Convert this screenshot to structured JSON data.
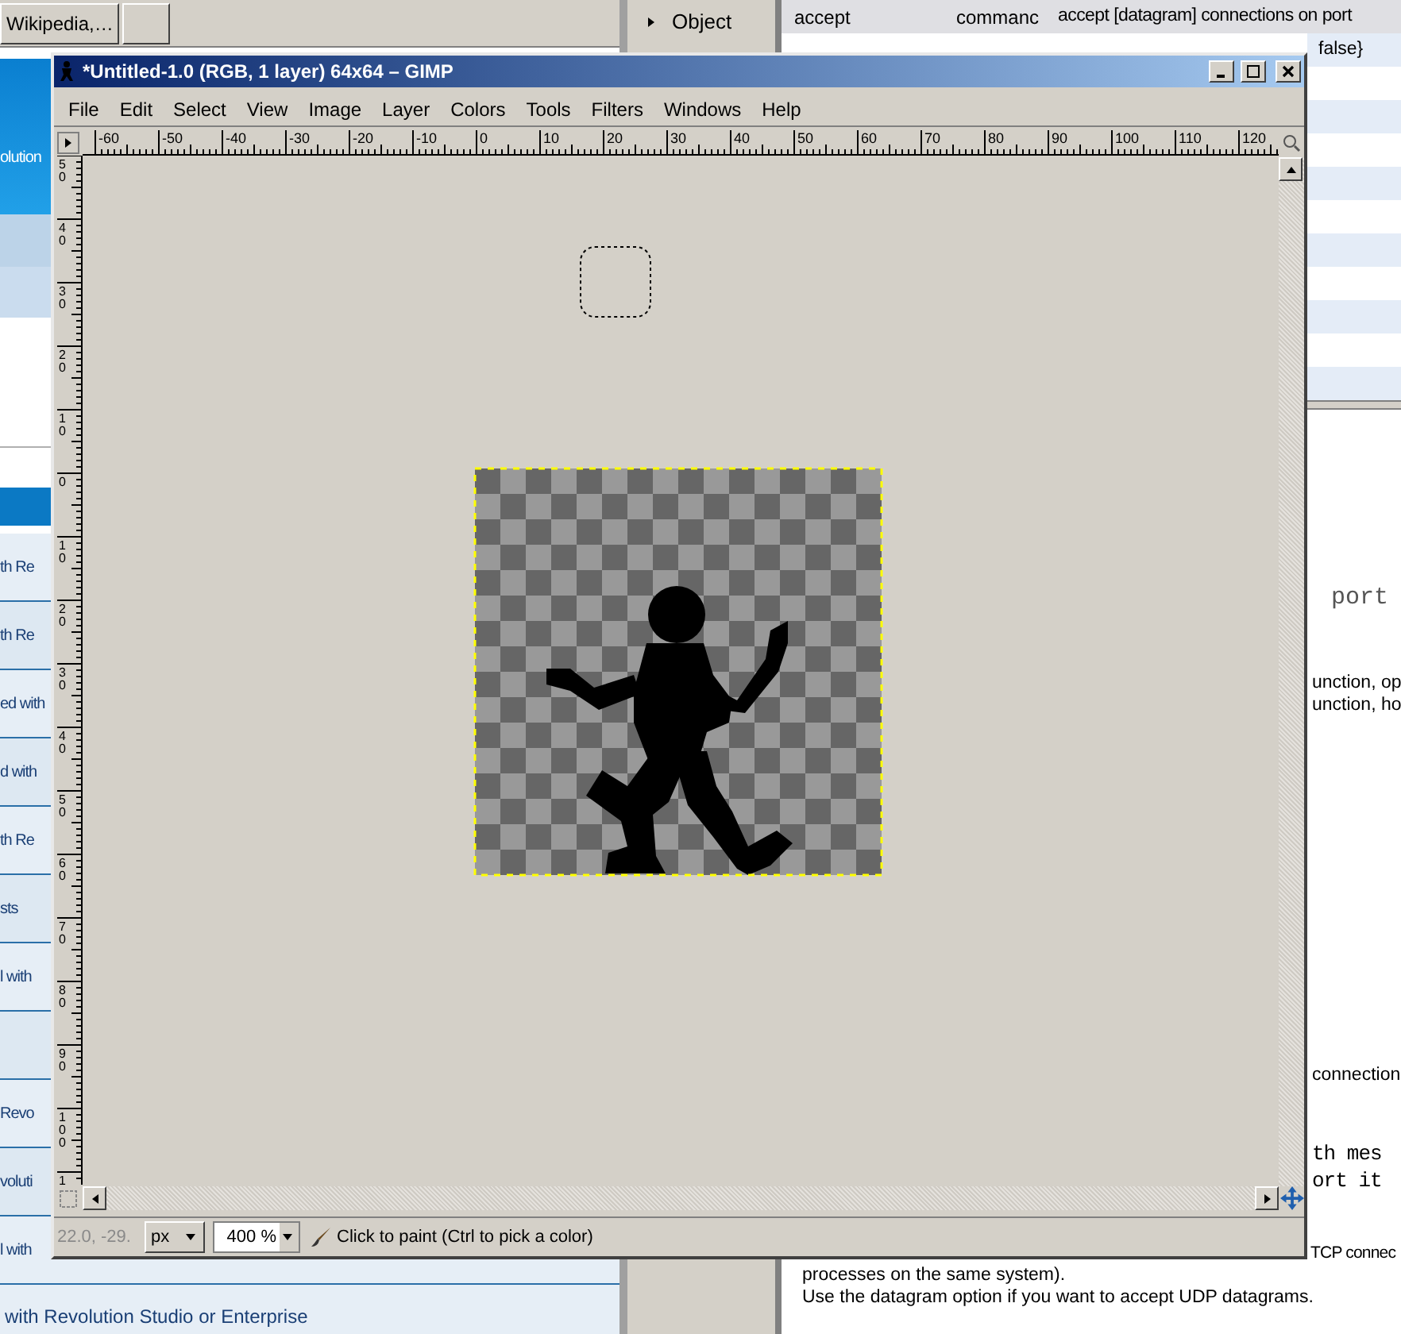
{
  "browser_tabs": [
    {
      "label": "Wikipedia,…"
    }
  ],
  "left_pane": {
    "header": "olution",
    "links": [
      {
        "kind": "link",
        "text": "th Re"
      },
      {
        "kind": "link",
        "text": "th Re"
      },
      {
        "kind": "link",
        "text": "ed with"
      },
      {
        "kind": "link",
        "text": "d with"
      },
      {
        "kind": "link",
        "text": "th Re"
      },
      {
        "kind": "link",
        "text": "sts"
      },
      {
        "kind": "link",
        "text": "l with"
      },
      {
        "kind": "blank"
      },
      {
        "kind": "link",
        "text": "Revo"
      },
      {
        "kind": "link",
        "text": "voluti"
      },
      {
        "kind": "link",
        "text": "l with"
      }
    ],
    "footer": "with Revolution Studio or Enterprise"
  },
  "object_list": {
    "item": "Object"
  },
  "dictionary_rows": [
    {
      "term": "accept",
      "type": "commanc",
      "summary": "accept [datagram] connections on port"
    }
  ],
  "dictionary_row_fragment": "false}",
  "doc": {
    "fragments": [
      {
        "kind": "code",
        "text": "port"
      },
      {
        "kind": "prose",
        "text": "unction, op"
      },
      {
        "kind": "prose",
        "text": "unction, ho"
      },
      {
        "kind": "prose",
        "text": "connection"
      },
      {
        "kind": "code",
        "text": "th mes"
      },
      {
        "kind": "code",
        "text": "ort it"
      }
    ],
    "tail": "TCP connec",
    "lines": [
      "processes on the same system).",
      "Use the datagram option if you want to accept UDP datagrams."
    ]
  },
  "gimp": {
    "title": "*Untitled-1.0 (RGB, 1 layer) 64x64 – GIMP",
    "menus": [
      "File",
      "Edit",
      "Select",
      "View",
      "Image",
      "Layer",
      "Colors",
      "Tools",
      "Filters",
      "Windows",
      "Help"
    ],
    "h_ruler": [
      "-60",
      "-50",
      "-40",
      "-30",
      "-20",
      "-10",
      "0",
      "10",
      "20",
      "30",
      "40",
      "50",
      "60",
      "70",
      "80",
      "90",
      "100",
      "110",
      "120"
    ],
    "v_ruler": [
      "50",
      "40",
      "30",
      "20",
      "10",
      "0",
      "10",
      "20",
      "30",
      "40",
      "50",
      "60",
      "70",
      "80",
      "90",
      "100",
      "1"
    ],
    "status": {
      "pointer": "22.0, -29.",
      "unit": "px",
      "zoom": "400 %",
      "message": "Click to paint (Ctrl to pick a color)"
    }
  }
}
